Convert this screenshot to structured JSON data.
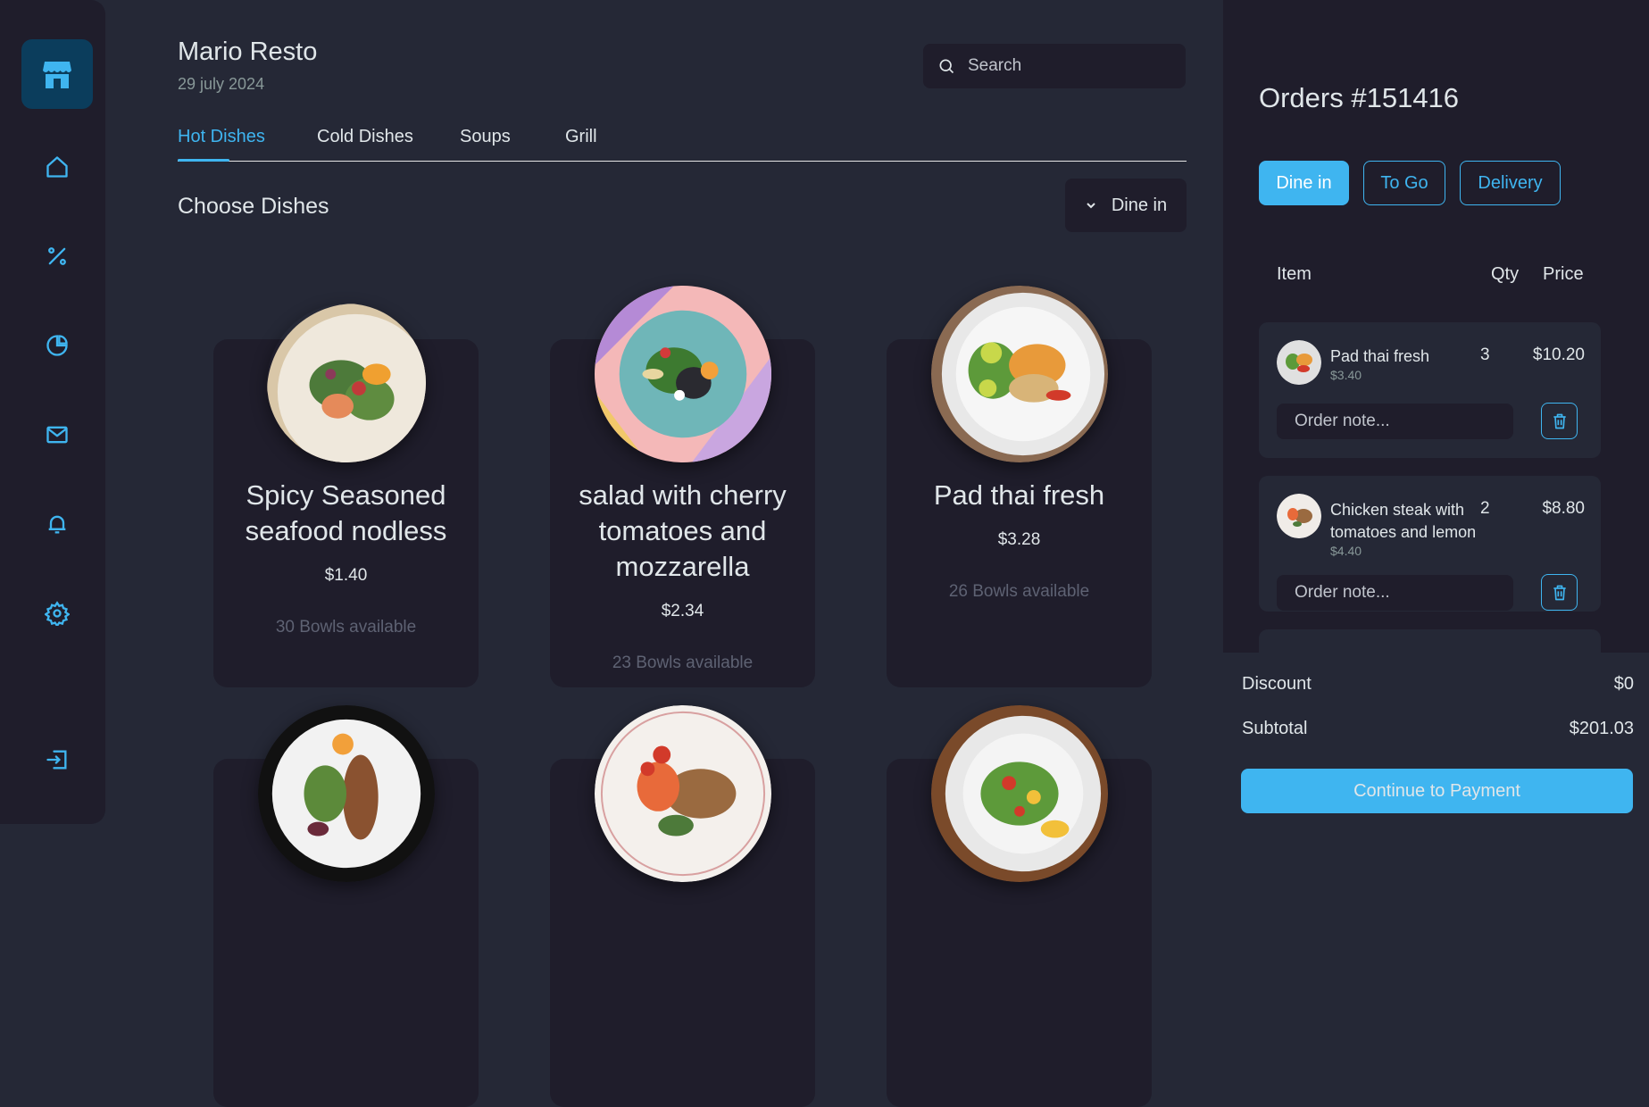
{
  "header": {
    "title": "Mario Resto",
    "date": "29 july 2024",
    "search_placeholder": "Search"
  },
  "tabs": [
    {
      "label": "Hot Dishes",
      "active": true
    },
    {
      "label": "Cold Dishes",
      "active": false
    },
    {
      "label": "Soups",
      "active": false
    },
    {
      "label": "Grill",
      "active": false
    }
  ],
  "section": {
    "title": "Choose Dishes",
    "dine_option": "Dine in"
  },
  "dishes": [
    {
      "name": "Spicy Seasoned seafood nodless",
      "price": "$1.40",
      "availability": "30 Bowls available"
    },
    {
      "name": "salad with cherry tomatoes and mozzarella",
      "price": "$2.34",
      "availability": "23 Bowls available"
    },
    {
      "name": "Pad thai fresh",
      "price": "$3.28",
      "availability": "26 Bowls available"
    }
  ],
  "sidebar": {
    "icons": [
      "store-icon",
      "home-icon",
      "discount-icon",
      "dashboard-icon",
      "mail-icon",
      "bell-icon",
      "settings-icon",
      "logout-icon"
    ]
  },
  "orders": {
    "title": "Orders #151416",
    "types": [
      "Dine in",
      "To Go",
      "Delivery"
    ],
    "columns": {
      "item": "Item",
      "qty": "Qty",
      "price": "Price"
    },
    "note_placeholder": "Order note...",
    "items": [
      {
        "name": "Pad thai fresh",
        "unit_price": "$3.40",
        "qty": "3",
        "total": "$10.20"
      },
      {
        "name": "Chicken steak with tomatoes and lemon",
        "unit_price": "$4.40",
        "qty": "2",
        "total": "$8.80"
      }
    ]
  },
  "summary": {
    "discount_label": "Discount",
    "discount_value": "$0",
    "subtotal_label": "Subtotal",
    "subtotal_value": "$201.03",
    "pay_label": "Continue to Payment"
  },
  "colors": {
    "accent": "#3fb5f0",
    "background": "#252836",
    "panel": "#1f1d2b"
  }
}
